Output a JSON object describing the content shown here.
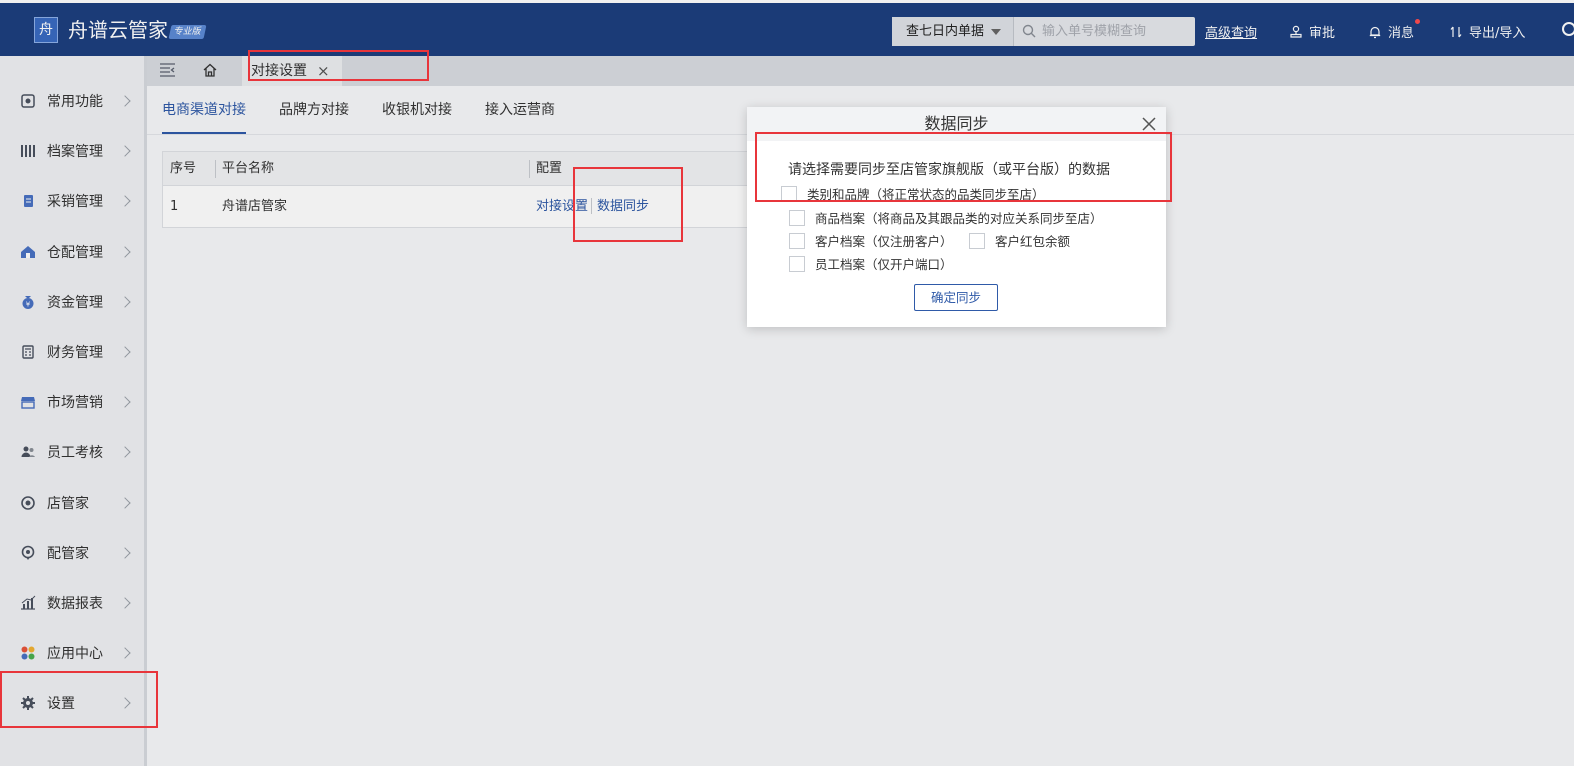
{
  "header": {
    "logo_glyph": "舟",
    "app_title": "舟谱云管家",
    "edition_badge": "专业版",
    "search": {
      "filter_selected": "查七日内单据",
      "placeholder": "输入单号模糊查询"
    },
    "advanced_query": "高级查询",
    "approve_label": "审批",
    "message_label": "消息",
    "export_import_label": "导出/导入"
  },
  "sidebar": {
    "items": [
      {
        "label": "常用功能",
        "icon": "star-icon"
      },
      {
        "label": "档案管理",
        "icon": "archive-icon"
      },
      {
        "label": "采销管理",
        "icon": "purchase-icon"
      },
      {
        "label": "仓配管理",
        "icon": "warehouse-icon"
      },
      {
        "label": "资金管理",
        "icon": "money-bag-icon"
      },
      {
        "label": "财务管理",
        "icon": "calculator-icon"
      },
      {
        "label": "市场营销",
        "icon": "store-icon"
      },
      {
        "label": "员工考核",
        "icon": "staff-icon"
      },
      {
        "label": "店管家",
        "icon": "shop-manager-icon"
      },
      {
        "label": "配管家",
        "icon": "delivery-manager-icon"
      },
      {
        "label": "数据报表",
        "icon": "chart-icon"
      },
      {
        "label": "应用中心",
        "icon": "apps-icon"
      },
      {
        "label": "设置",
        "icon": "gear-icon"
      }
    ]
  },
  "tabs": {
    "open_tab_label": "对接设置",
    "close_glyph": "×"
  },
  "subtabs": [
    "电商渠道对接",
    "品牌方对接",
    "收银机对接",
    "接入运营商"
  ],
  "table": {
    "headers": [
      "序号",
      "平台名称",
      "配置"
    ],
    "rows": [
      {
        "index": "1",
        "platform": "舟谱店管家",
        "action_settings": "对接设置",
        "action_sync": "数据同步"
      }
    ]
  },
  "dialog": {
    "title": "数据同步",
    "prompt": "请选择需要同步至店管家旗舰版（或平台版）的数据",
    "options": [
      "类别和品牌（将正常状态的品类同步至店）",
      "商品档案（将商品及其跟品类的对应关系同步至店）",
      "客户档案（仅注册客户）",
      "客户红包余额",
      "员工档案（仅开户端口）"
    ],
    "confirm_label": "确定同步"
  },
  "colors": {
    "header_bg": "#1d3f7f",
    "accent": "#2f5aa8",
    "annotation_red": "#e8353b"
  }
}
